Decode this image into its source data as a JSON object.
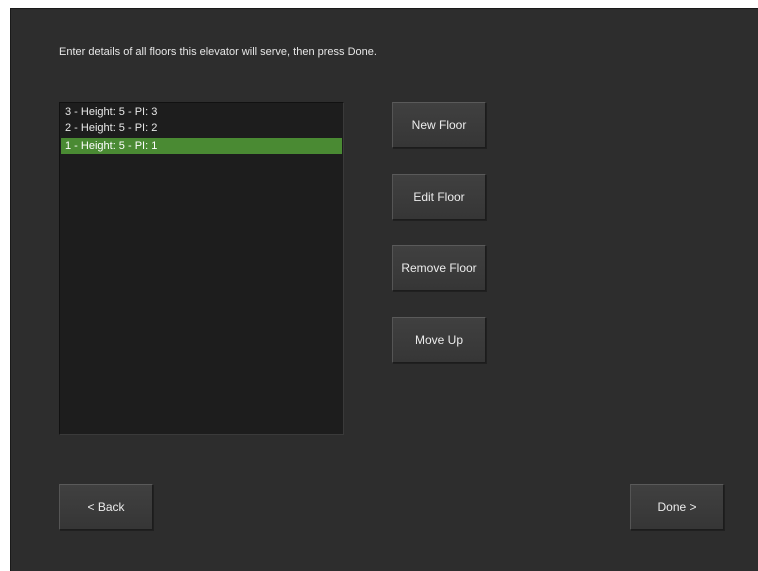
{
  "instruction": "Enter details of all floors this elevator will serve, then press Done.",
  "floors": [
    {
      "label": "3 - Height: 5 - PI: 3",
      "selected": false
    },
    {
      "label": "2 - Height: 5 - PI: 2",
      "selected": false
    },
    {
      "label": "1 - Height: 5 - PI: 1",
      "selected": true
    }
  ],
  "buttons": {
    "new_floor": "New Floor",
    "edit_floor": "Edit Floor",
    "remove_floor": "Remove Floor",
    "move_up": "Move Up",
    "back": "< Back",
    "done": "Done >"
  },
  "colors": {
    "background": "#2d2d2d",
    "list_background": "#1d1d1d",
    "selection": "#4a8a33",
    "text": "#e6e6e6"
  }
}
